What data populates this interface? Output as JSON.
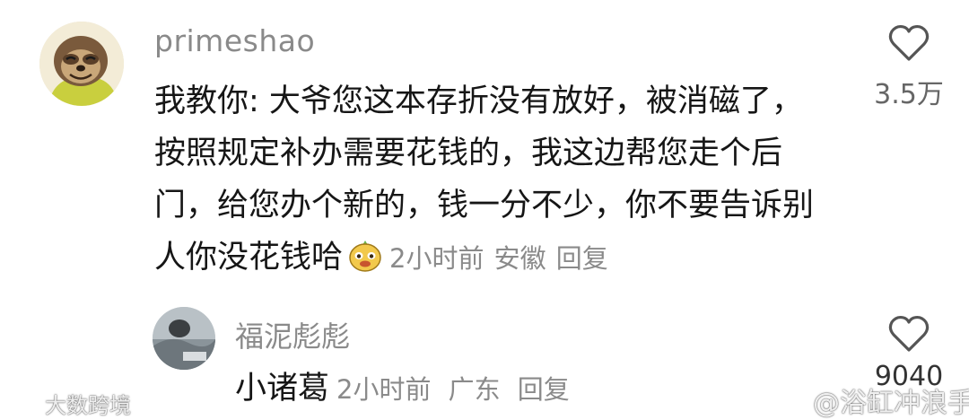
{
  "comments": [
    {
      "username": "primeshao",
      "text": "我教你: 大爷您这本存折没有放好，被消磁了，按照规定补办需要花钱的，我这边帮您走个后门，给您办个新的，钱一分不少，你不要告诉别人你没花钱哈",
      "emoji_icon": "smiling-face-emoji-icon",
      "time": "2小时前",
      "location": "安徽",
      "reply_label": "回复",
      "like_count": "3.5万"
    },
    {
      "username": "福泥彪彪",
      "text": "小诸葛",
      "time": "2小时前",
      "location": "广东",
      "reply_label": "回复",
      "like_count": "9040"
    }
  ],
  "watermarks": {
    "left": "大数跨境",
    "right": "@浴缸冲浪手"
  },
  "colors": {
    "meta_text": "#8a8a8a",
    "body_text": "#161616",
    "username": "#8a8a8a"
  }
}
